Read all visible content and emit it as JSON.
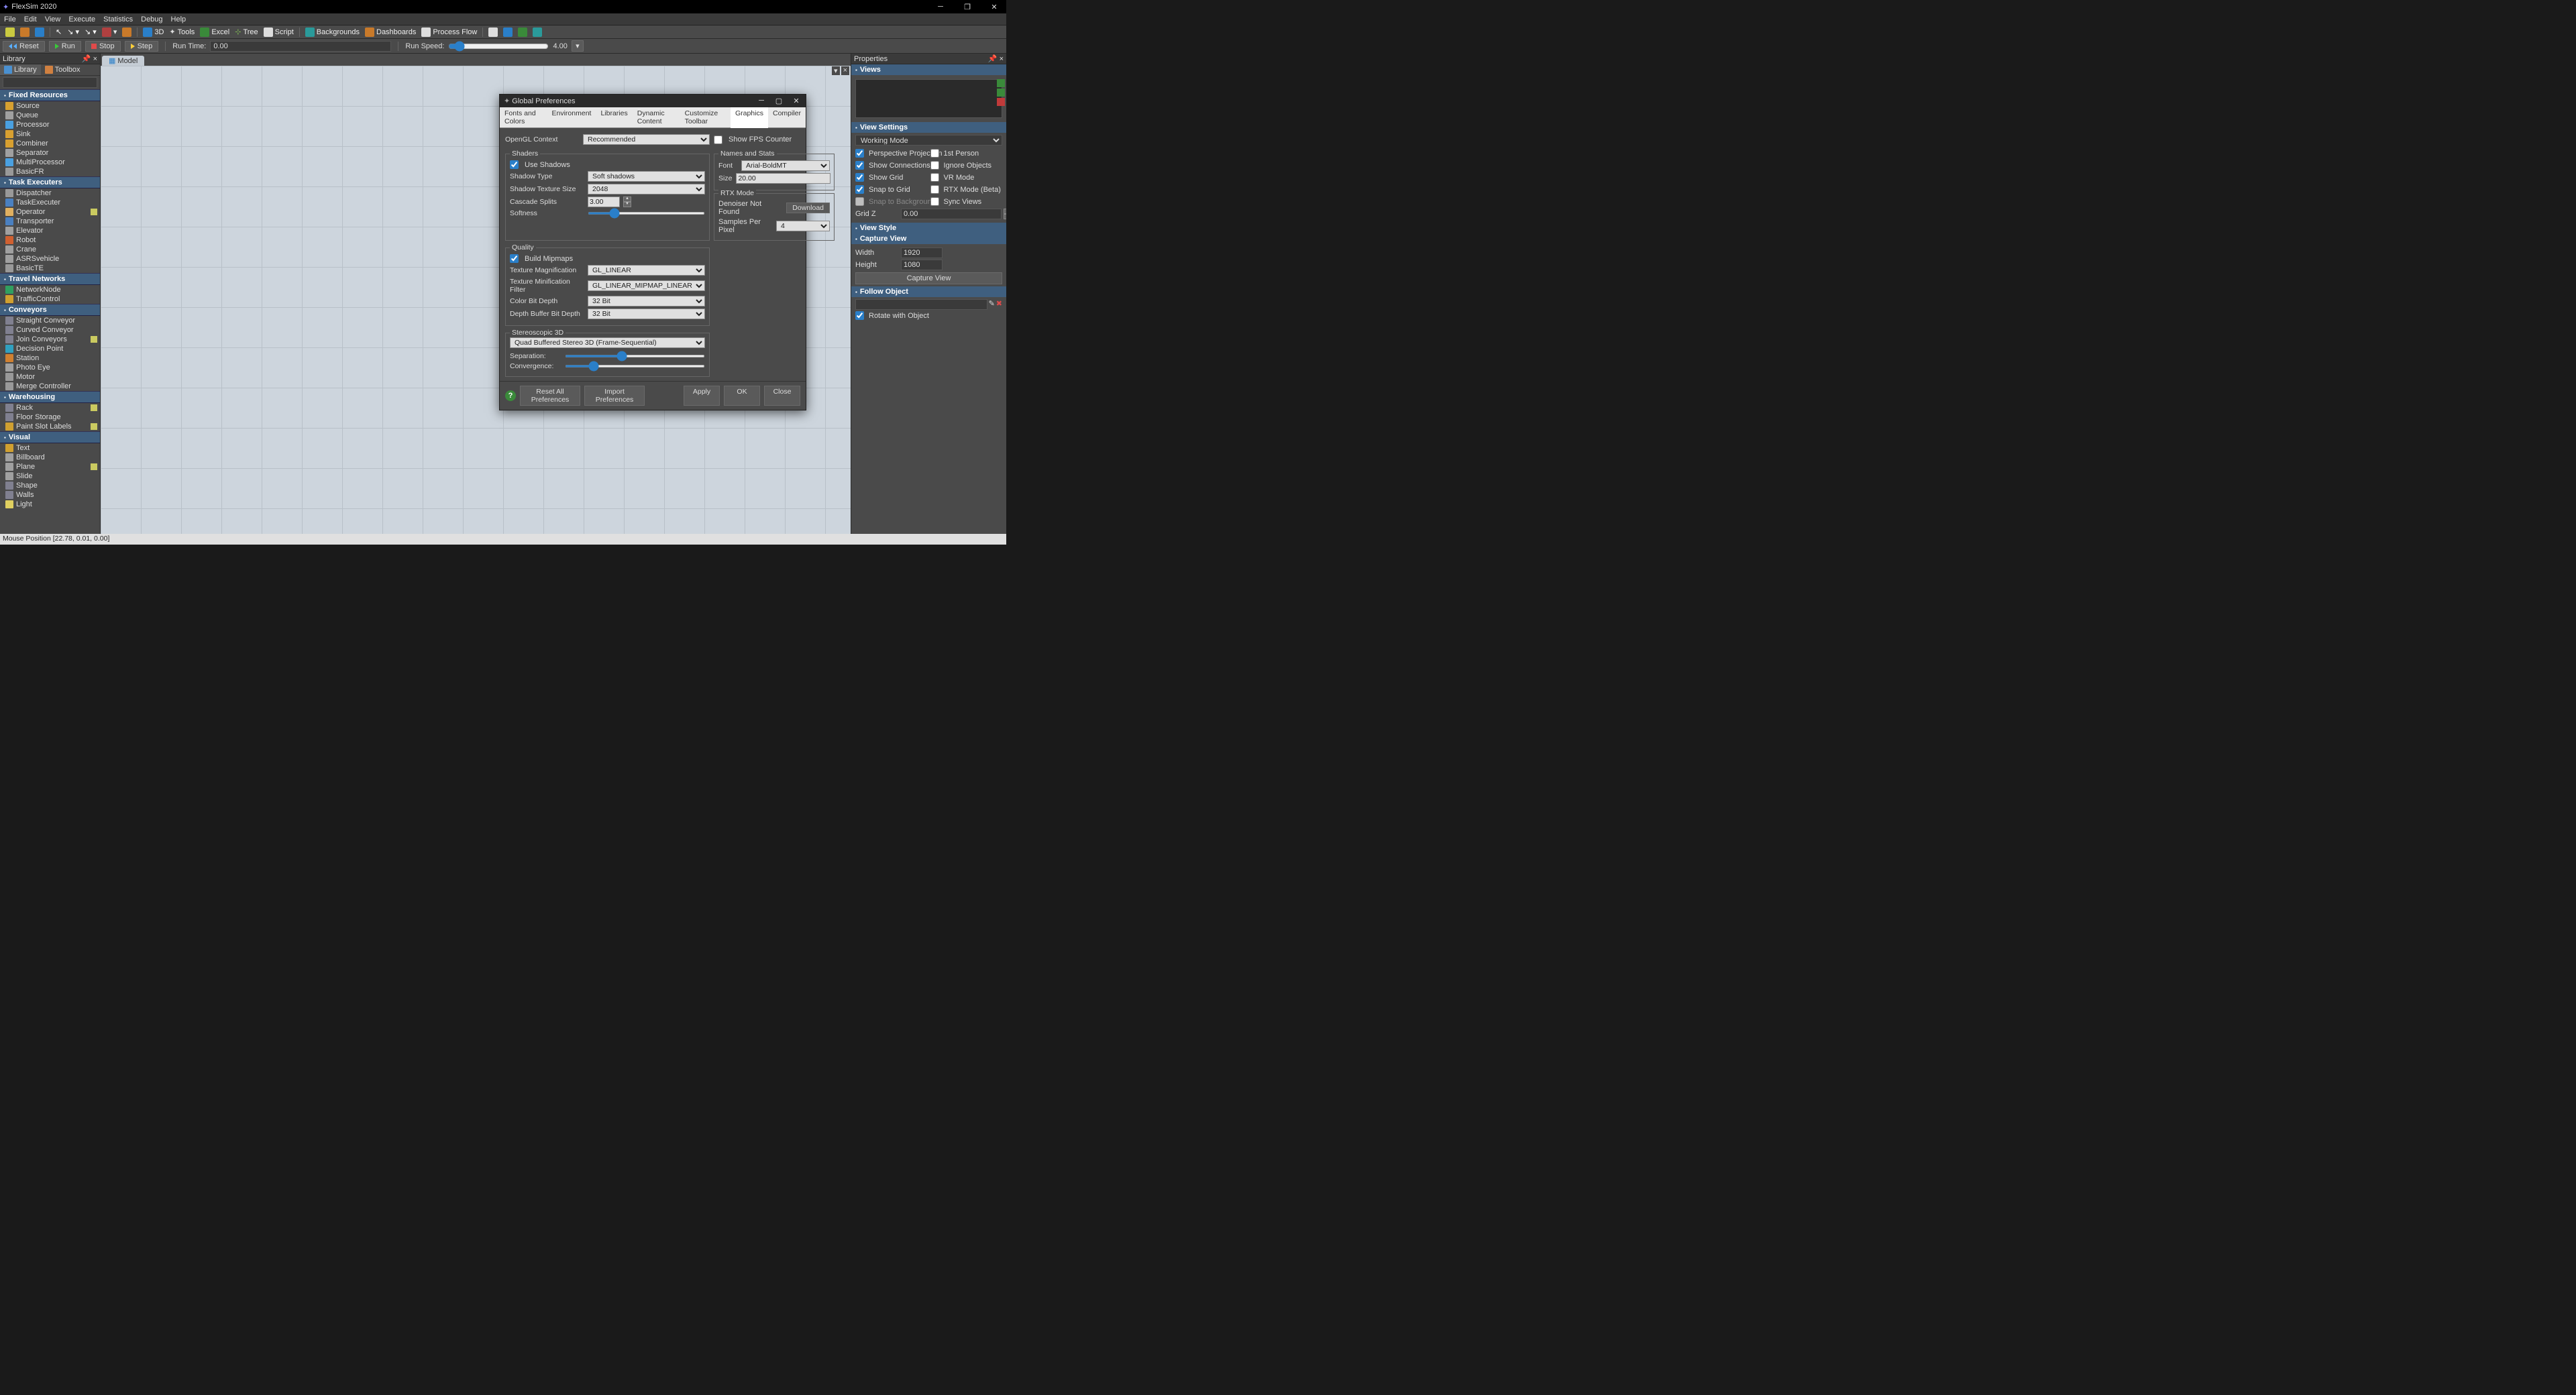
{
  "title": "FlexSim 2020",
  "menu": [
    "File",
    "Edit",
    "View",
    "Execute",
    "Statistics",
    "Debug",
    "Help"
  ],
  "toolbar": {
    "buttons": [
      "3D",
      "Tools",
      "Excel",
      "Tree",
      "Script",
      "Backgrounds",
      "Dashboards",
      "Process Flow"
    ]
  },
  "run": {
    "reset": "Reset",
    "run": "Run",
    "stop": "Stop",
    "step": "Step",
    "runtime_lbl": "Run Time:",
    "runtime_val": "0.00",
    "runspeed_lbl": "Run Speed:",
    "runspeed_val": "4.00"
  },
  "library": {
    "title": "Library",
    "tabs": {
      "library": "Library",
      "toolbox": "Toolbox"
    },
    "groups": [
      {
        "name": "Fixed Resources",
        "items": [
          {
            "n": "Source",
            "c": "#d8a030"
          },
          {
            "n": "Queue",
            "c": "#a0a0a0"
          },
          {
            "n": "Processor",
            "c": "#4aa0e0"
          },
          {
            "n": "Sink",
            "c": "#d8a030"
          },
          {
            "n": "Combiner",
            "c": "#d8a030"
          },
          {
            "n": "Separator",
            "c": "#a0a0a0"
          },
          {
            "n": "MultiProcessor",
            "c": "#4aa0e0"
          },
          {
            "n": "BasicFR",
            "c": "#999"
          }
        ]
      },
      {
        "name": "Task Executers",
        "items": [
          {
            "n": "Dispatcher",
            "c": "#999"
          },
          {
            "n": "TaskExecuter",
            "c": "#4a80c0"
          },
          {
            "n": "Operator",
            "c": "#e0b060",
            "tag": true
          },
          {
            "n": "Transporter",
            "c": "#4a80c0"
          },
          {
            "n": "Elevator",
            "c": "#a0a0a0"
          },
          {
            "n": "Robot",
            "c": "#d06030"
          },
          {
            "n": "Crane",
            "c": "#a0a0a0"
          },
          {
            "n": "ASRSvehicle",
            "c": "#a0a0a0"
          },
          {
            "n": "BasicTE",
            "c": "#999"
          }
        ]
      },
      {
        "name": "Travel Networks",
        "items": [
          {
            "n": "NetworkNode",
            "c": "#30a060"
          },
          {
            "n": "TrafficControl",
            "c": "#d0a030"
          }
        ]
      },
      {
        "name": "Conveyors",
        "items": [
          {
            "n": "Straight Conveyor",
            "c": "#808090"
          },
          {
            "n": "Curved Conveyor",
            "c": "#808090"
          },
          {
            "n": "Join Conveyors",
            "c": "#808090",
            "tag": true
          },
          {
            "n": "Decision Point",
            "c": "#30a0c0"
          },
          {
            "n": "Station",
            "c": "#d08030"
          },
          {
            "n": "Photo Eye",
            "c": "#a0a0a0"
          },
          {
            "n": "Motor",
            "c": "#999"
          },
          {
            "n": "Merge Controller",
            "c": "#999"
          }
        ]
      },
      {
        "name": "Warehousing",
        "items": [
          {
            "n": "Rack",
            "c": "#808090",
            "tag": true
          },
          {
            "n": "Floor Storage",
            "c": "#808090"
          },
          {
            "n": "Paint Slot Labels",
            "c": "#d0a030",
            "tag": true
          }
        ]
      },
      {
        "name": "Visual",
        "items": [
          {
            "n": "Text",
            "c": "#d0a030"
          },
          {
            "n": "Billboard",
            "c": "#a0a0a0"
          },
          {
            "n": "Plane",
            "c": "#a0a0a0",
            "tag": true
          },
          {
            "n": "Slide",
            "c": "#a0a0a0"
          },
          {
            "n": "Shape",
            "c": "#808090"
          },
          {
            "n": "Walls",
            "c": "#808090"
          },
          {
            "n": "Light",
            "c": "#e0d060"
          }
        ]
      }
    ]
  },
  "viewport": {
    "tab": "Model"
  },
  "properties": {
    "title": "Properties",
    "views": "Views",
    "view_settings": {
      "title": "View Settings",
      "mode": "Working Mode",
      "left": [
        {
          "l": "Perspective Projection",
          "v": true
        },
        {
          "l": "Show Connections",
          "v": true
        },
        {
          "l": "Show Grid",
          "v": true
        },
        {
          "l": "Snap to Grid",
          "v": true
        },
        {
          "l": "Snap to Background",
          "v": false,
          "disabled": true
        }
      ],
      "right": [
        {
          "l": "1st Person",
          "v": false
        },
        {
          "l": "Ignore Objects",
          "v": false
        },
        {
          "l": "VR Mode",
          "v": false
        },
        {
          "l": "RTX Mode (Beta)",
          "v": false
        },
        {
          "l": "Sync Views",
          "v": false
        }
      ],
      "gridz_lbl": "Grid Z",
      "gridz_val": "0.00"
    },
    "view_style": "View Style",
    "capture": {
      "title": "Capture View",
      "w_lbl": "Width",
      "w": "1920",
      "h_lbl": "Height",
      "h": "1080",
      "btn": "Capture View"
    },
    "follow": {
      "title": "Follow Object",
      "rotate": "Rotate with Object"
    }
  },
  "dialog": {
    "title": "Global Preferences",
    "tabs": [
      "Fonts and Colors",
      "Environment",
      "Libraries",
      "Dynamic Content",
      "Customize Toolbar",
      "Graphics",
      "Compiler"
    ],
    "active_tab": "Graphics",
    "opengl_lbl": "OpenGL Context",
    "opengl": "Recommended",
    "showfps": "Show FPS Counter",
    "shaders": {
      "title": "Shaders",
      "use_shadows": "Use Shadows",
      "shadow_type_lbl": "Shadow Type",
      "shadow_type": "Soft shadows",
      "tex_size_lbl": "Shadow Texture Size",
      "tex_size": "2048",
      "cascade_lbl": "Cascade Splits",
      "cascade": "3.00",
      "softness_lbl": "Softness"
    },
    "names": {
      "title": "Names and Stats",
      "font_lbl": "Font",
      "font": "Arial-BoldMT",
      "size_lbl": "Size",
      "size": "20.00"
    },
    "rtx": {
      "title": "RTX Mode",
      "denoiser": "Denoiser Not Found",
      "download": "Download",
      "spp_lbl": "Samples Per Pixel",
      "spp": "4"
    },
    "quality": {
      "title": "Quality",
      "mipmaps": "Build Mipmaps",
      "texmag_lbl": "Texture Magnification",
      "texmag": "GL_LINEAR",
      "texmin_lbl": "Texture Minification Filter",
      "texmin": "GL_LINEAR_MIPMAP_LINEAR",
      "colordepth_lbl": "Color Bit Depth",
      "colordepth": "32 Bit",
      "depthbuf_lbl": "Depth Buffer Bit Depth",
      "depthbuf": "32 Bit"
    },
    "stereo": {
      "title": "Stereoscopic 3D",
      "mode": "Quad Buffered Stereo 3D (Frame-Sequential)",
      "sep_lbl": "Separation:",
      "conv_lbl": "Convergence:"
    },
    "footer": {
      "reset": "Reset All Preferences",
      "import": "Import Preferences",
      "apply": "Apply",
      "ok": "OK",
      "close": "Close"
    }
  },
  "status": "Mouse Position [22.78, 0.01, 0.00]"
}
